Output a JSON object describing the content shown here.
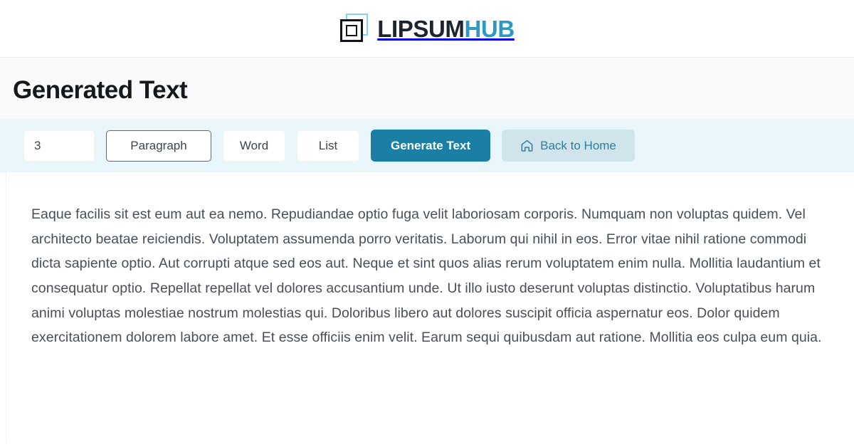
{
  "brand": {
    "logo_icon": "nested-squares-logo-icon",
    "name_part1": "LIPSUM",
    "name_part2": "HUB",
    "color_dark": "#1d2430",
    "color_accent": "#2b9bc4"
  },
  "page": {
    "title": "Generated Text"
  },
  "toolbar": {
    "count_value": "3",
    "count_placeholder": "3",
    "type_options": [
      {
        "label": "Paragraph",
        "selected": true
      },
      {
        "label": "Word",
        "selected": false
      },
      {
        "label": "List",
        "selected": false
      }
    ],
    "generate_label": "Generate Text",
    "back_home_label": "Back to Home",
    "back_home_icon": "home-icon",
    "primary_color": "#1b7fa5",
    "ghost_bg_color": "#cfe5eb",
    "ghost_text_color": "#2d7e9c",
    "band_bg_color": "#e9f6fb"
  },
  "content": {
    "paragraph": "Eaque facilis sit est eum aut ea nemo. Repudiandae optio fuga velit laboriosam corporis. Numquam non voluptas quidem. Vel architecto beatae reiciendis. Voluptatem assumenda porro veritatis. Laborum qui nihil in eos. Error vitae nihil ratione commodi dicta sapiente optio. Aut corrupti atque sed eos aut. Neque et sint quos alias rerum voluptatem enim nulla. Mollitia laudantium et consequatur optio. Repellat repellat vel dolores accusantium unde. Ut illo iusto deserunt voluptas distinctio. Voluptatibus harum animi voluptas molestiae nostrum molestias qui. Doloribus libero aut dolores suscipit officia aspernatur eos. Dolor quidem exercitationem dolorem labore amet. Et esse officiis enim velit. Earum sequi quibusdam aut ratione. Mollitia eos culpa eum quia."
  }
}
